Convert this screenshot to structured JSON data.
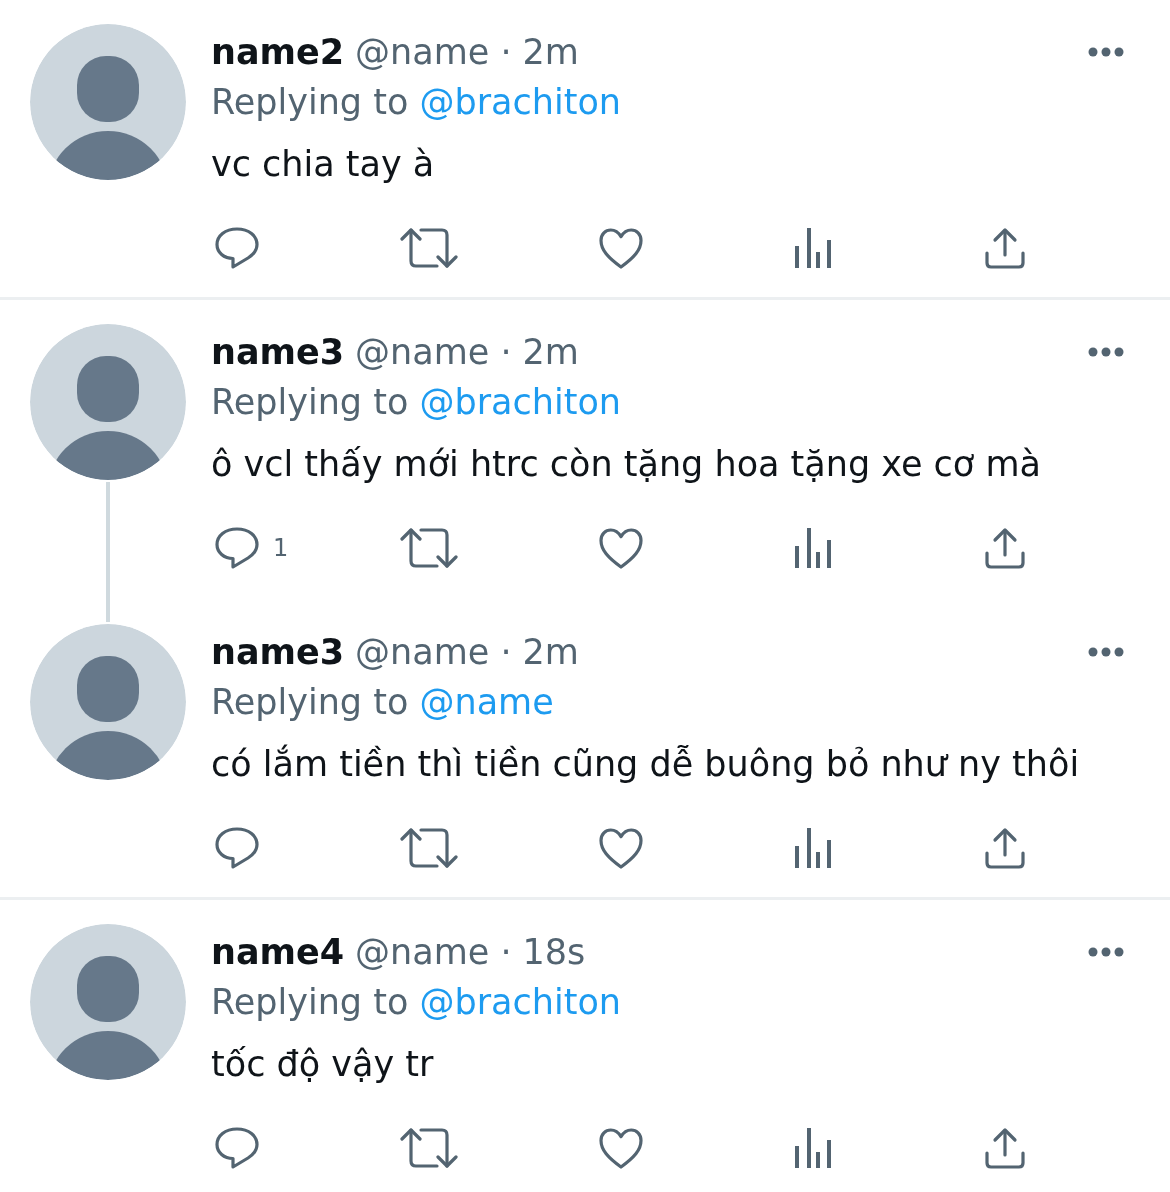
{
  "tweets": [
    {
      "author": {
        "name": "name2",
        "handle": "@name"
      },
      "separator": "·",
      "time": "2m",
      "replying": {
        "label": "Replying to",
        "handle": "@brachiton"
      },
      "text": "vc chia tay à",
      "thread_continues": false,
      "actions": [
        {
          "kind": "reply"
        },
        {
          "kind": "repost"
        },
        {
          "kind": "like"
        },
        {
          "kind": "views"
        },
        {
          "kind": "share"
        }
      ]
    },
    {
      "author": {
        "name": "name3",
        "handle": "@name"
      },
      "separator": "·",
      "time": "2m",
      "replying": {
        "label": "Replying to",
        "handle": "@brachiton"
      },
      "text": "ô vcl thấy mới htrc còn tặng hoa tặng xe cơ mà",
      "thread_continues": true,
      "actions": [
        {
          "kind": "reply",
          "count": "1"
        },
        {
          "kind": "repost"
        },
        {
          "kind": "like"
        },
        {
          "kind": "views"
        },
        {
          "kind": "share"
        }
      ]
    },
    {
      "author": {
        "name": "name3",
        "handle": "@name"
      },
      "separator": "·",
      "time": "2m",
      "replying": {
        "label": "Replying to",
        "handle": "@name"
      },
      "text": "có lắm tiền thì tiền cũng dễ buông bỏ như ny thôi",
      "thread_continues": false,
      "actions": [
        {
          "kind": "reply"
        },
        {
          "kind": "repost"
        },
        {
          "kind": "like"
        },
        {
          "kind": "views"
        },
        {
          "kind": "share"
        }
      ]
    },
    {
      "author": {
        "name": "name4",
        "handle": "@name"
      },
      "separator": "·",
      "time": "18s",
      "replying": {
        "label": "Replying to",
        "handle": "@brachiton"
      },
      "text": "tốc độ vậy tr",
      "thread_continues": false,
      "actions": [
        {
          "kind": "reply"
        },
        {
          "kind": "repost"
        },
        {
          "kind": "like"
        },
        {
          "kind": "views"
        },
        {
          "kind": "share"
        }
      ]
    }
  ]
}
